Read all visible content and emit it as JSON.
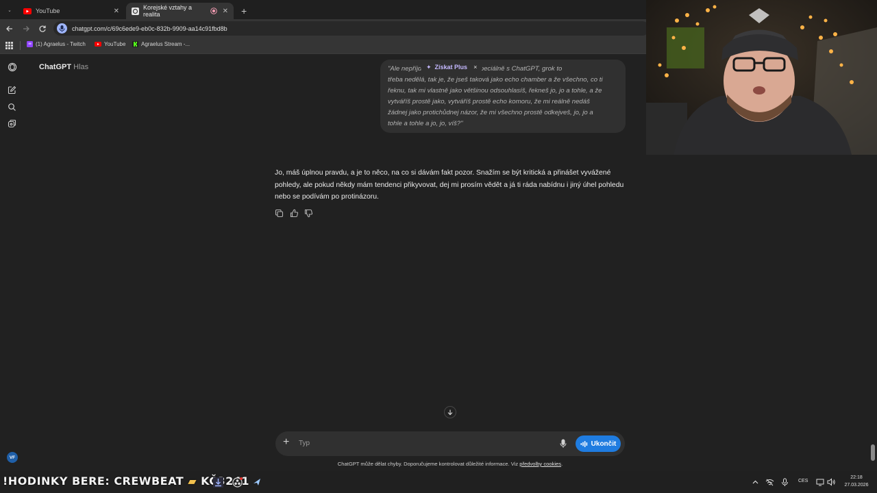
{
  "browser": {
    "tabs": [
      {
        "label": "YouTube",
        "active": false
      },
      {
        "label": "Korejské vztahy a realita",
        "active": true
      }
    ],
    "url": "chatgpt.com/c/69c6ede9-eb0c-832b-9909-aa14c91fbd8b",
    "bookmarks": [
      {
        "label": "(1) Agraelus - Twitch",
        "icon": "twitch-icon"
      },
      {
        "label": "YouTube",
        "icon": "youtube-icon"
      },
      {
        "label": "Agraelus Stream -...",
        "icon": "kick-icon"
      }
    ]
  },
  "app": {
    "title": "ChatGPT",
    "mode": "Hlas",
    "upgrade_label": "Získat Plus",
    "upgrade_close": "×",
    "user_message_lines": [
      "\"Ale nepříjde mi jako by s AI a speciálně s ChatGPT, grok to",
      "třeba nedělá, tak je, že jseš taková jako echo chamber a že všechno, co ti",
      "řeknu, tak mi vlastně jako většinou odsouhlasíš, řekneš jo, jo a tohle, a že",
      "vytváříš prostě jako, vytváříš prostě echo komoru, že mi reálně nedáš",
      "žádnej jako protichůdnej názor, že mi všechno prostě odkejveš, jo, jo a",
      "tohle a tohle a jo, jo, víš?\""
    ],
    "assistant_reply": "Jo, máš úplnou pravdu, a je to něco, na co si dávám fakt pozor. Snažím se být kritická a přinášet vyvážené pohledy, ale pokud někdy mám tendenci přikyvovat, dej mi prosím vědět a já ti ráda nabídnu i jiný úhel pohledu nebo se podívám po protinázoru.",
    "composer_placeholder": "Typ",
    "end_button": "Ukončit",
    "disclaimer": "ChatGPT může dělat chyby. Doporučujeme kontrolovat důležité informace. Viz",
    "disclaimer_link": "předvolby cookies",
    "disclaimer_end": ".",
    "avatar_initials": "VF"
  },
  "taskbar": {
    "ticker": "!HODINKY BERE: CREWBEAT",
    "ticker_amount": "KČ3241",
    "language": "CES",
    "time": "22:18",
    "date": "27.03.2026"
  },
  "colors": {
    "accent": "#1f7ce0",
    "background": "#212121",
    "bubble": "#303030",
    "plus_purple": "#c5b9ff"
  }
}
